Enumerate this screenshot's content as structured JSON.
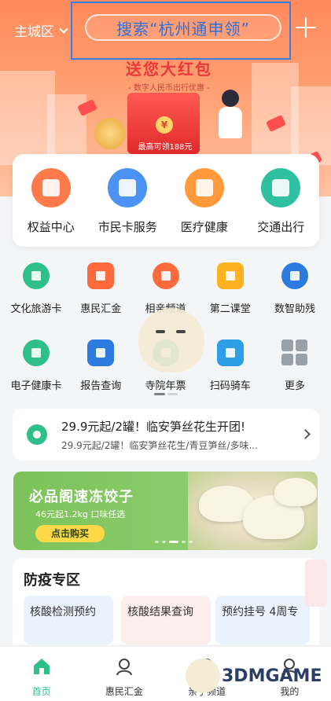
{
  "header": {
    "city": "主城区",
    "search_text": "搜索“杭州通申领”"
  },
  "promo": {
    "title": "送您大红包",
    "subtitle": "- 数字人民币出行优惠 -",
    "max_text": "最高可领188元",
    "coin_symbol": "¥"
  },
  "services": [
    {
      "label": "权益中心",
      "color": "#ff7a4a",
      "icon": "diamond-icon"
    },
    {
      "label": "市民卡服务",
      "color": "#4b93f2",
      "icon": "card-icon"
    },
    {
      "label": "医疗健康",
      "color": "#ff9a3a",
      "icon": "medical-kit-icon"
    },
    {
      "label": "交通出行",
      "color": "#2fc0a0",
      "icon": "bus-icon"
    }
  ],
  "grid": [
    [
      {
        "label": "文化旅游卡",
        "color": "#2fbf8a",
        "icon": "ticket-icon"
      },
      {
        "label": "惠民汇金",
        "color": "#ff6a3d",
        "icon": "money-bag-icon"
      },
      {
        "label": "相亲频道",
        "color": "#ff6a3d",
        "icon": "couple-icon"
      },
      {
        "label": "第二课堂",
        "color": "#ffb21f",
        "icon": "classroom-icon"
      },
      {
        "label": "数智助残",
        "color": "#2e7be0",
        "icon": "assist-icon"
      }
    ],
    [
      {
        "label": "电子健康卡",
        "color": "#2fbf8a",
        "icon": "health-card-icon"
      },
      {
        "label": "报告查询",
        "color": "#2e7be0",
        "icon": "report-icon"
      },
      {
        "label": "寺院年票",
        "color": "#2fbf8a",
        "icon": "temple-icon"
      },
      {
        "label": "扫码骑车",
        "color": "#2e9ee6",
        "icon": "bike-icon"
      },
      {
        "label": "更多",
        "color": "#9aa0a8",
        "icon": "more-grid-icon"
      }
    ]
  ],
  "news": {
    "title": "29.9元起/2罐！临安笋丝花生开团!",
    "subtitle": "29.9元起/2罐！临安笋丝花生/青豆笋丝/多味..."
  },
  "ad": {
    "title": "必品阁速冻饺子",
    "subtitle": "46元起1.2kg 口味任选",
    "button": "点击购买"
  },
  "epidemic": {
    "title": "防疫专区",
    "cards": [
      {
        "label": "核酸检测预约",
        "bg": "#eaf3fd"
      },
      {
        "label": "核酸结果查询",
        "bg": "#fdeeee"
      },
      {
        "label": "预约挂号 4周专",
        "bg": "#eaf3fd"
      }
    ]
  },
  "tabbar": {
    "items": [
      {
        "label": "首页",
        "icon": "home-icon",
        "active": true
      },
      {
        "label": "惠民汇金",
        "icon": "money-bag-icon",
        "active": false
      },
      {
        "label": "亲子频道",
        "icon": "family-icon",
        "active": false
      },
      {
        "label": "我的",
        "icon": "user-icon",
        "active": false
      }
    ]
  },
  "watermark": {
    "text": "3DMGAME"
  },
  "colors": {
    "accent_green": "#2fbf8a",
    "banner_orange": "#ff8a5c",
    "search_blue": "#2e6fd8"
  }
}
